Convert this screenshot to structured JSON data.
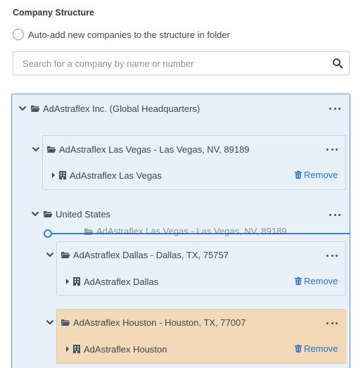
{
  "section": {
    "title": "Company Structure"
  },
  "auto_add": {
    "label": "Auto-add new companies to the structure in folder",
    "checked": false
  },
  "search": {
    "placeholder": "Search for a company by name or number",
    "value": ""
  },
  "tree": {
    "root": {
      "label": "AdAstraflex Inc. (Global Headquarters)",
      "expanded": true
    },
    "las_vegas_folder": {
      "label": "AdAstraflex Las Vegas - Las Vegas, NV, 89189",
      "expanded": true
    },
    "las_vegas_company": {
      "label": "AdAstraflex Las Vegas",
      "remove_label": "Remove"
    },
    "us_folder": {
      "label": "United States",
      "expanded": true
    },
    "drag_ghost": {
      "label": "AdAstraflex Las Vegas - Las Vegas, NV, 89189"
    },
    "dallas_folder": {
      "label": "AdAstraflex Dallas - Dallas, TX, 75757",
      "expanded": true
    },
    "dallas_company": {
      "label": "AdAstraflex Dallas",
      "remove_label": "Remove"
    },
    "houston_folder": {
      "label": "AdAstraflex Houston - Houston, TX, 77007",
      "expanded": true
    },
    "houston_company": {
      "label": "AdAstraflex Houston",
      "remove_label": "Remove"
    }
  },
  "colors": {
    "accent": "#2b74c7",
    "tree_bg": "#e8f0f9",
    "tree_border": "#5b8fc9",
    "highlight_bg": "#f2d9b8",
    "drop_indicator": "#3d7cc7"
  },
  "icons": {
    "search": "search-icon",
    "chevron": "chevron-down-icon",
    "folder": "folder-open-icon",
    "more": "more-horizontal-icon",
    "caret": "caret-right-icon",
    "building": "building-icon",
    "trash": "trash-icon"
  }
}
